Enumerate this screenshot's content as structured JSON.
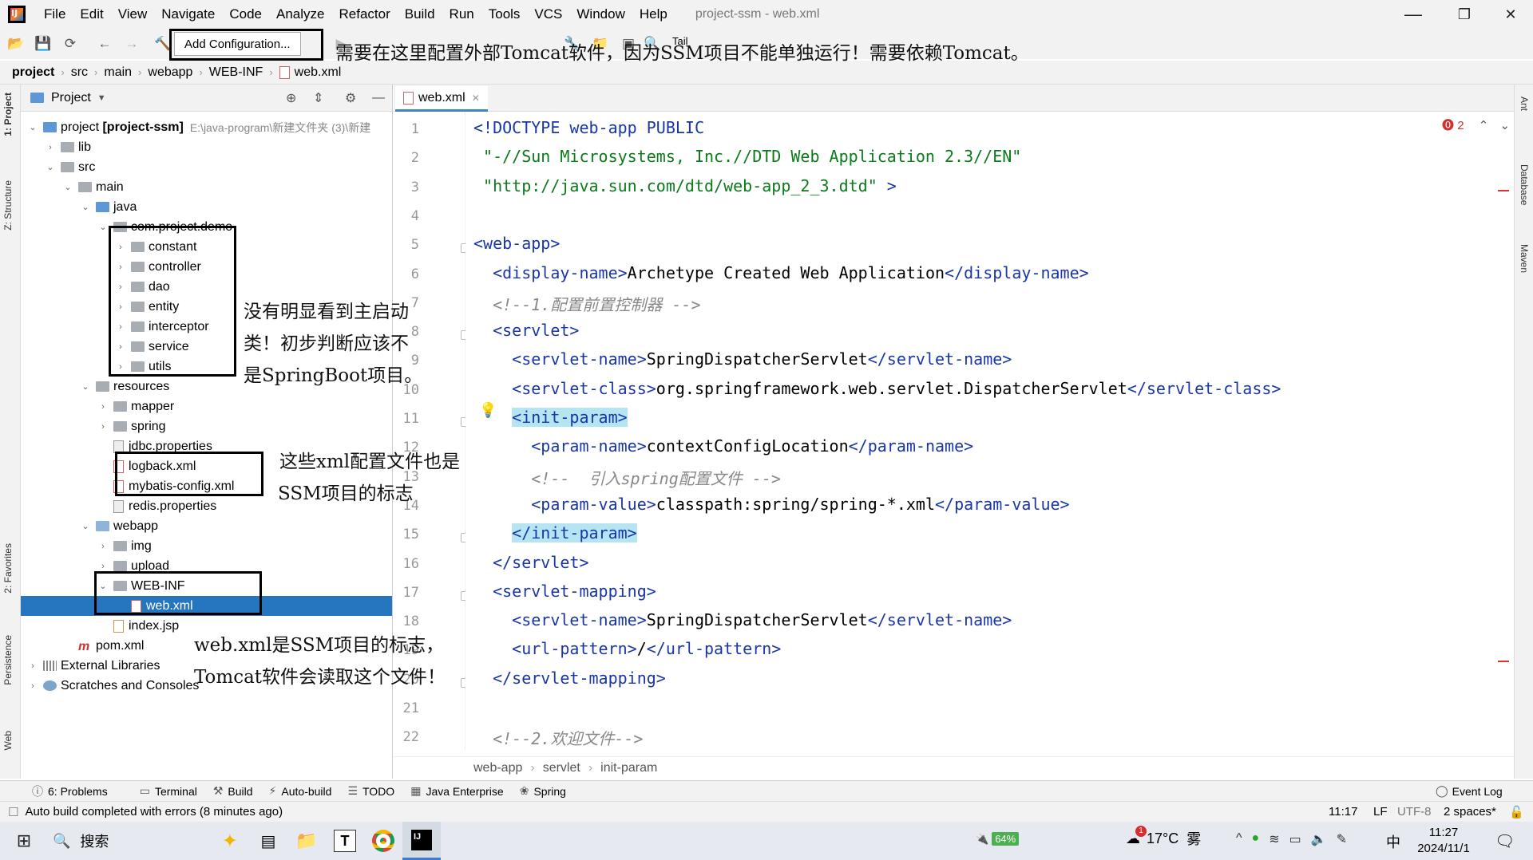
{
  "title_bar": {
    "menu": [
      "File",
      "Edit",
      "View",
      "Navigate",
      "Code",
      "Analyze",
      "Refactor",
      "Build",
      "Run",
      "Tools",
      "VCS",
      "Window",
      "Help"
    ],
    "window_title": "project-ssm - web.xml",
    "minimize": "—",
    "maximize": "❐",
    "close": "✕"
  },
  "toolbar": {
    "add_configuration": "Add Configuration...",
    "tail_label": "Tail"
  },
  "breadcrumb": [
    "project",
    "src",
    "main",
    "webapp",
    "WEB-INF",
    "web.xml"
  ],
  "left_strip": {
    "project": "1: Project",
    "structure": "Z: Structure",
    "favorites": "2: Favorites",
    "persistence": "Persistence",
    "web": "Web"
  },
  "right_strip": {
    "ant": "Ant",
    "database": "Database",
    "maven": "Maven"
  },
  "project_panel": {
    "title": "Project",
    "tree": [
      {
        "label": "project [project-ssm]",
        "hint": "E:\\java-program\\新建文件夹 (3)\\新建",
        "level": 0,
        "chev": "open",
        "icon": "folder-blue"
      },
      {
        "label": "lib",
        "level": 1,
        "chev": "closed",
        "icon": "folder"
      },
      {
        "label": "src",
        "level": 1,
        "chev": "open",
        "icon": "folder"
      },
      {
        "label": "main",
        "level": 2,
        "chev": "open",
        "icon": "folder"
      },
      {
        "label": "java",
        "level": 3,
        "chev": "open",
        "icon": "folder-blue"
      },
      {
        "label": "com.project.demo",
        "level": 4,
        "chev": "open",
        "icon": "folder"
      },
      {
        "label": "constant",
        "level": 5,
        "chev": "closed",
        "icon": "folder"
      },
      {
        "label": "controller",
        "level": 5,
        "chev": "closed",
        "icon": "folder"
      },
      {
        "label": "dao",
        "level": 5,
        "chev": "closed",
        "icon": "folder"
      },
      {
        "label": "entity",
        "level": 5,
        "chev": "closed",
        "icon": "folder"
      },
      {
        "label": "interceptor",
        "level": 5,
        "chev": "closed",
        "icon": "folder"
      },
      {
        "label": "service",
        "level": 5,
        "chev": "closed",
        "icon": "folder"
      },
      {
        "label": "utils",
        "level": 5,
        "chev": "closed",
        "icon": "folder"
      },
      {
        "label": "resources",
        "level": 3,
        "chev": "open",
        "icon": "folder"
      },
      {
        "label": "mapper",
        "level": 4,
        "chev": "closed",
        "icon": "folder"
      },
      {
        "label": "spring",
        "level": 4,
        "chev": "closed",
        "icon": "folder"
      },
      {
        "label": "jdbc.properties",
        "level": 4,
        "chev": "none",
        "icon": "props"
      },
      {
        "label": "logback.xml",
        "level": 4,
        "chev": "none",
        "icon": "xml"
      },
      {
        "label": "mybatis-config.xml",
        "level": 4,
        "chev": "none",
        "icon": "xml"
      },
      {
        "label": "redis.properties",
        "level": 4,
        "chev": "none",
        "icon": "props"
      },
      {
        "label": "webapp",
        "level": 3,
        "chev": "open",
        "icon": "folder-web"
      },
      {
        "label": "img",
        "level": 4,
        "chev": "closed",
        "icon": "folder"
      },
      {
        "label": "upload",
        "level": 4,
        "chev": "closed",
        "icon": "folder"
      },
      {
        "label": "WEB-INF",
        "level": 4,
        "chev": "open",
        "icon": "folder"
      },
      {
        "label": "web.xml",
        "level": 5,
        "chev": "none",
        "icon": "xml",
        "selected": true
      },
      {
        "label": "index.jsp",
        "level": 4,
        "chev": "none",
        "icon": "jsp"
      },
      {
        "label": "pom.xml",
        "level": 2,
        "chev": "none",
        "icon": "mvn"
      },
      {
        "label": "External Libraries",
        "level": 0,
        "chev": "closed",
        "icon": "libs"
      },
      {
        "label": "Scratches and Consoles",
        "level": 0,
        "chev": "closed",
        "icon": "scratch"
      }
    ]
  },
  "annotations": {
    "top": "需要在这里配置外部Tomcat软件，因为SSM项目不能单独运行！需要依赖Tomcat。",
    "middle_1": "没有明显看到主启动",
    "middle_2": "类！初步判断应该不",
    "middle_3": "是SpringBoot项目。",
    "xml_1": "这些xml配置文件也是",
    "xml_2": "SSM项目的标志",
    "webxml_1": "web.xml是SSM项目的标志，",
    "webxml_2": "Tomcat软件会读取这个文件！"
  },
  "editor": {
    "tab": "web.xml",
    "error_count": "2",
    "lines": [
      {
        "n": "1",
        "html": "<span class='tag'>&lt;!DOCTYPE</span> <span class='tag'>web-app</span> <span class='tag'>PUBLIC</span>"
      },
      {
        "n": "2",
        "html": " <span class='str'>\"-//Sun Microsystems, Inc.//DTD Web Application 2.3//EN\"</span>"
      },
      {
        "n": "3",
        "html": " <span class='str'>\"http://java.sun.com/dtd/web-app_2_3.dtd\"</span> <span class='tag'>&gt;</span>"
      },
      {
        "n": "4",
        "html": ""
      },
      {
        "n": "5",
        "html": "<span class='tag'>&lt;web-app&gt;</span>"
      },
      {
        "n": "6",
        "html": "  <span class='tag'>&lt;display-name&gt;</span>Archetype Created Web Application<span class='tag'>&lt;/display-name&gt;</span>"
      },
      {
        "n": "7",
        "html": "  <span class='cmt'>&lt;!--1.配置前置控制器 --&gt;</span>"
      },
      {
        "n": "8",
        "html": "  <span class='tag'>&lt;servlet&gt;</span>"
      },
      {
        "n": "9",
        "html": "    <span class='tag'>&lt;servlet-name&gt;</span>SpringDispatcherServlet<span class='tag'>&lt;/servlet-name&gt;</span>"
      },
      {
        "n": "10",
        "html": "    <span class='tag'>&lt;servlet-class&gt;</span>org.springframework.web.servlet.DispatcherServlet<span class='tag'>&lt;/servlet-class&gt;</span>"
      },
      {
        "n": "11",
        "html": "    <span class='tag hl'>&lt;init-param&gt;</span>"
      },
      {
        "n": "12",
        "html": "      <span class='tag'>&lt;param-name&gt;</span>contextConfigLocation<span class='tag'>&lt;/param-name&gt;</span>"
      },
      {
        "n": "13",
        "html": "      <span class='cmt'>&lt;!--  引入spring配置文件 --&gt;</span>"
      },
      {
        "n": "14",
        "html": "      <span class='tag'>&lt;param-value&gt;</span>classpath:spring/spring-*.xml<span class='tag'>&lt;/param-value&gt;</span>"
      },
      {
        "n": "15",
        "html": "    <span class='tag hl'>&lt;/init-param&gt;</span>"
      },
      {
        "n": "16",
        "html": "  <span class='tag'>&lt;/servlet&gt;</span>"
      },
      {
        "n": "17",
        "html": "  <span class='tag'>&lt;servlet-mapping&gt;</span>"
      },
      {
        "n": "18",
        "html": "    <span class='tag'>&lt;servlet-name&gt;</span>SpringDispatcherServlet<span class='tag'>&lt;/servlet-name&gt;</span>"
      },
      {
        "n": "19",
        "html": "    <span class='tag'>&lt;url-pattern&gt;</span>/<span class='tag'>&lt;/url-pattern&gt;</span>"
      },
      {
        "n": "20",
        "html": "  <span class='tag'>&lt;/servlet-mapping&gt;</span>"
      },
      {
        "n": "21",
        "html": ""
      },
      {
        "n": "22",
        "html": "  <span class='cmt'>&lt;!--2.欢迎文件--&gt;</span>"
      }
    ],
    "status_path": [
      "web-app",
      "servlet",
      "init-param"
    ]
  },
  "bottom_tabs": [
    {
      "icon": "ⓘ",
      "label": "6: Problems"
    },
    {
      "icon": "▭",
      "label": "Terminal"
    },
    {
      "icon": "⚒",
      "label": "Build"
    },
    {
      "icon": "⚡",
      "label": "Auto-build"
    },
    {
      "icon": "☰",
      "label": "TODO"
    },
    {
      "icon": "▦",
      "label": "Java Enterprise"
    },
    {
      "icon": "❀",
      "label": "Spring"
    }
  ],
  "event_log": "Event Log",
  "status": {
    "message": "Auto build completed with errors (8 minutes ago)",
    "position": "11:17",
    "line_sep": "LF",
    "encoding": "UTF-8",
    "indent": "2 spaces*"
  },
  "taskbar": {
    "search": "搜索",
    "battery": "64%",
    "weather_temp": "17°C",
    "weather_desc": "雾",
    "ime": "中",
    "time": "11:27",
    "date": "2024/11/1",
    "notification_badge": "1"
  }
}
